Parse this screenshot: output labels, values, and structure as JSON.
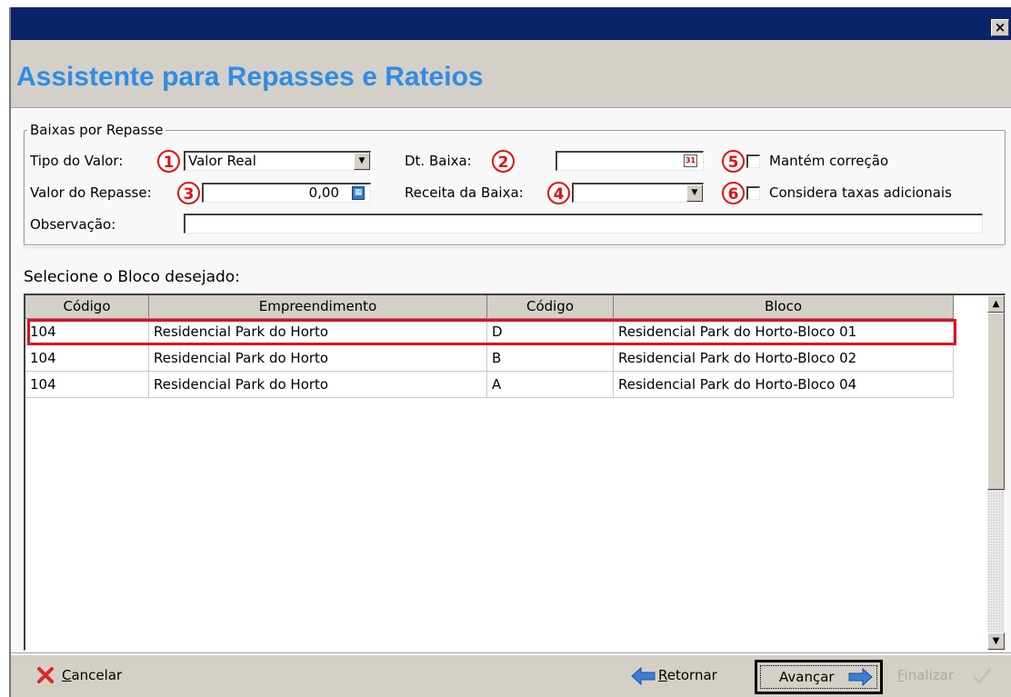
{
  "window": {
    "close_label": "×",
    "wizard_title": "Assistente para Repasses e Rateios"
  },
  "group": {
    "legend": "Baixas por Repasse",
    "tipo_valor_label": "Tipo do Valor:",
    "tipo_valor_value": "Valor Real",
    "dt_baixa_label": "Dt. Baixa:",
    "dt_baixa_value": "",
    "mantem_correcao_label": "Mantém correção",
    "valor_repasse_label": "Valor do Repasse:",
    "valor_repasse_value": "0,00",
    "receita_baixa_label": "Receita da Baixa:",
    "receita_baixa_value": "",
    "considera_taxas_label": "Considera taxas adicionais",
    "observacao_label": "Observação:",
    "observacao_value": ""
  },
  "badges": [
    "1",
    "2",
    "3",
    "4",
    "5",
    "6"
  ],
  "grid": {
    "prompt": "Selecione o Bloco desejado:",
    "columns": [
      "Código",
      "Empreendimento",
      "Código",
      "Bloco"
    ],
    "rows": [
      [
        "104",
        "Residencial Park do Horto",
        "D",
        "Residencial Park do Horto-Bloco 01"
      ],
      [
        "104",
        "Residencial Park do Horto",
        "B",
        "Residencial Park do Horto-Bloco 02"
      ],
      [
        "104",
        "Residencial Park do Horto",
        "A",
        "Residencial Park do Horto-Bloco 04"
      ]
    ],
    "highlighted_row": 0
  },
  "footer": {
    "cancelar_underlined": "C",
    "cancelar_rest": "ancelar",
    "retornar_underlined": "R",
    "retornar_rest": "etornar",
    "avancar_underlined": "A",
    "avancar_rest": "vançar",
    "finalizar_underlined": "F",
    "finalizar_rest": "inalizar"
  },
  "colors": {
    "title_bar": "#0a246a",
    "wizard_title": "#2f8de4",
    "annotation_red": "#e01010",
    "arrow_blue": "#3a7fd5",
    "cancel_red": "#d42a2a"
  },
  "icons": [
    "close-icon",
    "dropdown-arrow-icon",
    "calendar-icon",
    "calculator-icon",
    "cancel-x-icon",
    "arrow-left-icon",
    "arrow-right-icon",
    "checkmark-icon"
  ]
}
